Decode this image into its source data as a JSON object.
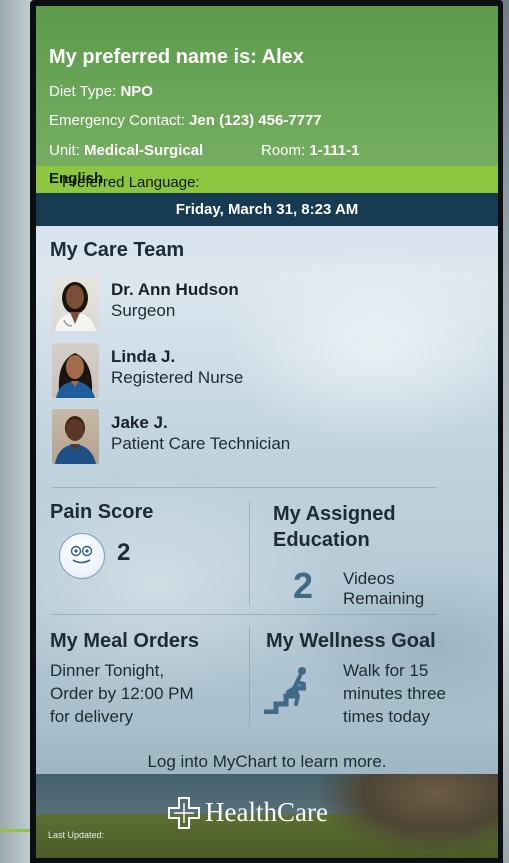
{
  "header": {
    "preferred_name": "My preferred name is: Alex",
    "diet_label": "Diet Type: ",
    "diet_value": "NPO",
    "emergency_label": "Emergency Contact: ",
    "emergency_value": "Jen (123) 456-7777",
    "unit_label": "Unit: ",
    "unit_value": "Medical-Surgical",
    "room_label": "Room: ",
    "room_value": "1-111-1",
    "language_label": "Preferred Language: ",
    "language_value": "English",
    "datetime": "Friday, March 31, 8:23 AM"
  },
  "care_team": {
    "title": "My Care Team",
    "members": [
      {
        "name": "Dr. Ann Hudson",
        "role": "Surgeon"
      },
      {
        "name": "Linda J.",
        "role": "Registered Nurse"
      },
      {
        "name": "Jake J.",
        "role": "Patient Care Technician"
      }
    ]
  },
  "pain": {
    "title": "Pain Score",
    "score": "2"
  },
  "education": {
    "title": "My Assigned Education",
    "count": "2",
    "line1": "Videos",
    "line2": "Remaining"
  },
  "meals": {
    "title": "My Meal Orders",
    "line1": "Dinner Tonight,",
    "line2": "Order by 12:00 PM",
    "line3": "for delivery"
  },
  "wellness": {
    "title": "My Wellness Goal",
    "line1": "Walk for 15",
    "line2": "minutes three",
    "line3": "times today"
  },
  "mychart_prompt": "Log into MyChart to learn more.",
  "footer": {
    "brand": "HealthCare",
    "last_updated": "Last Updated:"
  },
  "icons": {
    "pain_face": "smiley-face-icon",
    "walker": "stairs-walker-icon",
    "logo": "healthcare-cross-icon"
  },
  "colors": {
    "header_green": "#6aa558",
    "language_bar": "#8cc63f",
    "date_bar": "#173b52",
    "accent_blue": "#3f6b86"
  }
}
